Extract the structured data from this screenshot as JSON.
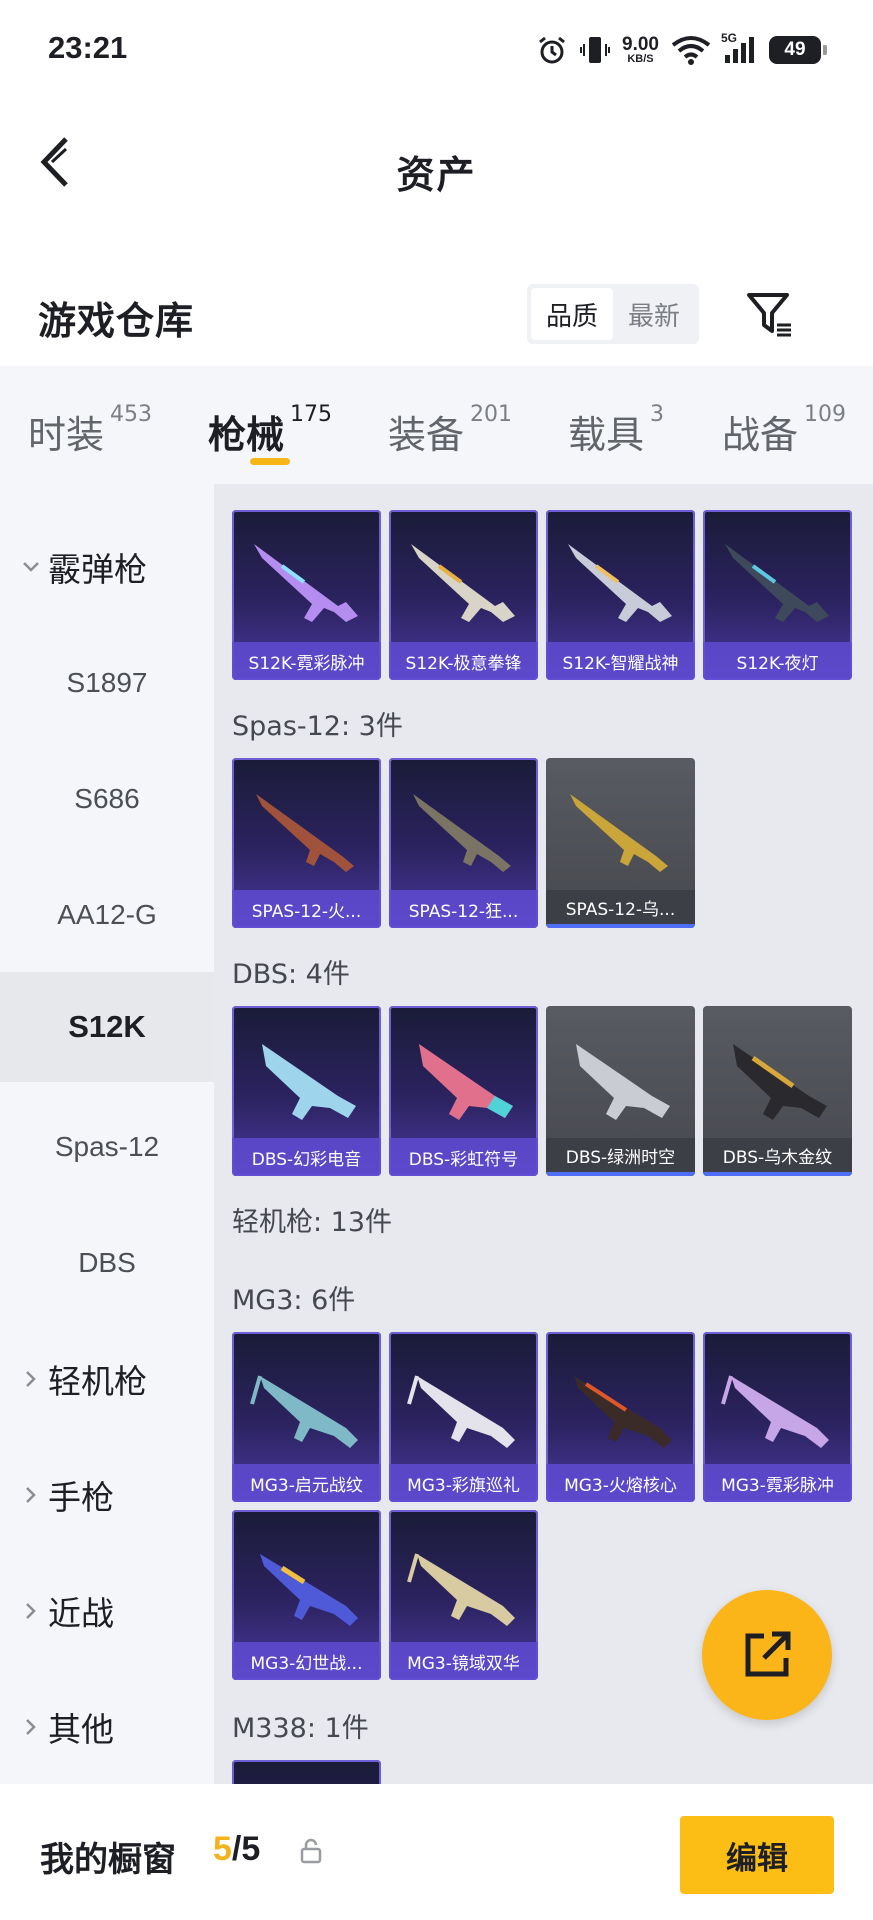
{
  "status_bar": {
    "time": "23:21",
    "net_speed": "9.00",
    "net_unit": "KB/S",
    "signal": "5G",
    "battery": "49"
  },
  "nav": {
    "title": "资产"
  },
  "section": {
    "title": "游戏仓库",
    "sort_quality": "品质",
    "sort_newest": "最新"
  },
  "tabs": [
    {
      "label": "时装",
      "count": "453"
    },
    {
      "label": "枪械",
      "count": "175"
    },
    {
      "label": "装备",
      "count": "201"
    },
    {
      "label": "载具",
      "count": "3"
    },
    {
      "label": "战备",
      "count": "109"
    }
  ],
  "sidebar": {
    "shotgun": "霰弹枪",
    "subs": [
      "S1897",
      "S686",
      "AA12-G",
      "S12K",
      "Spas-12",
      "DBS"
    ],
    "lmg": "轻机枪",
    "pistol": "手枪",
    "melee": "近战",
    "other": "其他"
  },
  "groups": {
    "s12k_items": [
      "S12K-霓彩脉冲",
      "S12K-极意拳锋",
      "S12K-智耀战神",
      "S12K-夜灯"
    ],
    "spas_title": "Spas-12: 3件",
    "spas_items": [
      "SPAS-12-火...",
      "SPAS-12-狂...",
      "SPAS-12-乌..."
    ],
    "dbs_title": "DBS: 4件",
    "dbs_items": [
      "DBS-幻彩电音",
      "DBS-彩虹符号",
      "DBS-绿洲时空",
      "DBS-乌木金纹"
    ],
    "lmg_title": "轻机枪: 13件",
    "mg3_title": "MG3: 6件",
    "mg3_items": [
      "MG3-启元战纹",
      "MG3-彩旗巡礼",
      "MG3-火熔核心",
      "MG3-霓彩脉冲",
      "MG3-幻世战...",
      "MG3-镜域双华"
    ],
    "m338_title": "M338: 1件"
  },
  "bottom": {
    "label": "我的橱窗",
    "count_current": "5",
    "count_sep": "/",
    "count_total": "5",
    "edit": "编辑"
  },
  "colors": {
    "accent": "#fcbe14",
    "card_purple": "#2c2361",
    "card_gray": "#4f5157",
    "tab_bg": "#f4f6f9",
    "content_bg": "#e7e9ee"
  }
}
